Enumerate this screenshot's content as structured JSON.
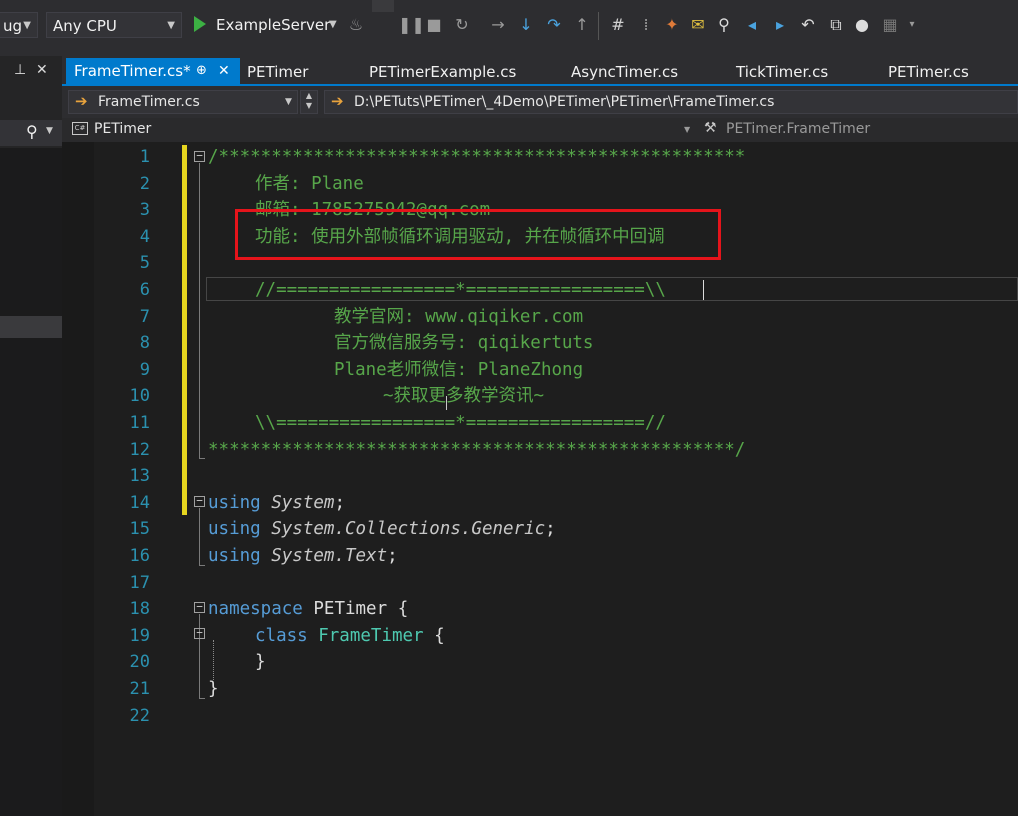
{
  "toolbar": {
    "config_fragment": "ug",
    "platform": "Any CPU",
    "run_target": "ExampleServer"
  },
  "left_panel": {
    "pin_glyph": "⊥",
    "close_glyph": "✕",
    "search_glyph": "⚲"
  },
  "tabs": [
    {
      "label": "FrameTimer.cs*",
      "active": true
    },
    {
      "label": "PETimer"
    },
    {
      "label": "PETimerExample.cs"
    },
    {
      "label": "AsyncTimer.cs"
    },
    {
      "label": "TickTimer.cs"
    },
    {
      "label": "PETimer.cs"
    }
  ],
  "nav": {
    "file_combo": "FrameTimer.cs",
    "path": "D:\\PETuts\\PETimer\\_4Demo\\PETimer\\PETimer\\FrameTimer.cs",
    "project": "PETimer",
    "member": "PETimer.FrameTimer"
  },
  "line_numbers": [
    "1",
    "2",
    "3",
    "4",
    "5",
    "6",
    "7",
    "8",
    "9",
    "10",
    "11",
    "12",
    "13",
    "14",
    "15",
    "16",
    "17",
    "18",
    "19",
    "20",
    "21",
    "22"
  ],
  "code": {
    "l1": "/**************************************************",
    "l2": "作者: Plane",
    "l3": "邮箱: 1785275942@qq.com",
    "l4": "功能: 使用外部帧循环调用驱动, 并在帧循环中回调",
    "l6": "//=================*=================\\\\",
    "l7": "教学官网: www.qiqiker.com",
    "l8": "官方微信服务号: qiqikertuts",
    "l9": "Plane老师微信: PlaneZhong",
    "l10": "~获取更多教学资讯~",
    "l11": "\\\\=================*=================//",
    "l12": "**************************************************/",
    "kw_using": "using",
    "ns_system": "System",
    "ns_collections": "System.Collections.Generic",
    "ns_text": "System.Text",
    "semi": ";",
    "kw_namespace": "namespace",
    "ns_name": "PETimer",
    "kw_class": "class",
    "class_name": "FrameTimer",
    "open_brace": "{",
    "close_brace": "}"
  },
  "colors": {
    "accent": "#007acc",
    "comment": "#57a64a",
    "keyword": "#569cd6",
    "type": "#4ec9b0",
    "highlight_box": "#e5141b",
    "change_bar": "#e6d51f"
  }
}
